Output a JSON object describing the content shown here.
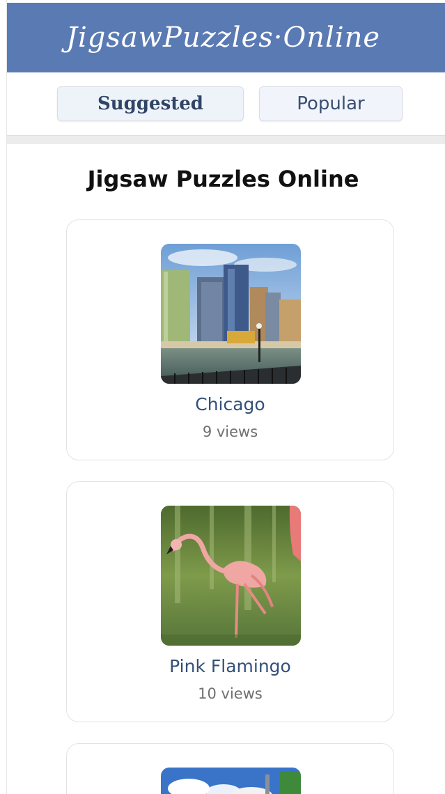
{
  "header": {
    "brand": "JigsawPuzzles·Online"
  },
  "tabs": [
    {
      "label": "Suggested",
      "active": true
    },
    {
      "label": "Popular",
      "active": false
    }
  ],
  "page": {
    "title": "Jigsaw Puzzles Online"
  },
  "puzzles": [
    {
      "title": "Chicago",
      "views": "9 views",
      "image": "city-skyline-river-photo"
    },
    {
      "title": "Pink Flamingo",
      "views": "10 views",
      "image": "pink-flamingo-water-photo"
    },
    {
      "title": "",
      "views": "",
      "image": "sky-clouds-tower-photo"
    }
  ],
  "colors": {
    "header": "#5a7ab3",
    "tab_bg": "#eef3fa",
    "link": "#34507a"
  }
}
